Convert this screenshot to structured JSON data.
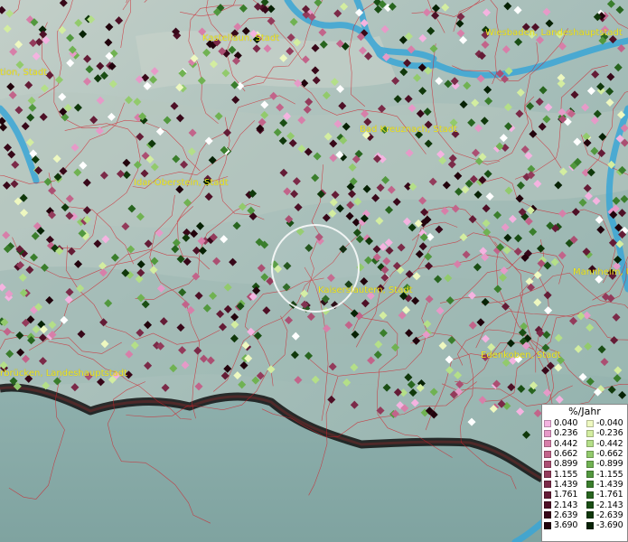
{
  "map": {
    "cities": [
      {
        "name": "Kastellaun, Stadt"
      },
      {
        "name": "Wiesbaden, Landeshauptstadt"
      },
      {
        "name": "tion, Stadt"
      },
      {
        "name": "Bad Kreuznach, Stadt"
      },
      {
        "name": "Idar-Oberstein, Stadt"
      },
      {
        "name": "Kaiserslautern, Stadt"
      },
      {
        "name": "Mannheim, U"
      },
      {
        "name": "rbrücken, Landeshauptstadt"
      },
      {
        "name": "Edenkoben, Stadt"
      }
    ],
    "colors": {
      "background": "#9fb8b4",
      "river": "#3aa6d6",
      "boundaries": "#d0202a",
      "label": "#f4ea1e",
      "circle": "#ffffff"
    }
  },
  "legend": {
    "title": "%/Jahr",
    "positive": [
      {
        "label": "0.040",
        "color": "#f4b3e0"
      },
      {
        "label": "0.236",
        "color": "#e69ac8"
      },
      {
        "label": "0.442",
        "color": "#d77fa9"
      },
      {
        "label": "0.662",
        "color": "#c2648a"
      },
      {
        "label": "0.899",
        "color": "#ab4f72"
      },
      {
        "label": "1.155",
        "color": "#933b5b"
      },
      {
        "label": "1.439",
        "color": "#7b2a48"
      },
      {
        "label": "1.761",
        "color": "#641c36"
      },
      {
        "label": "2.143",
        "color": "#4e1026"
      },
      {
        "label": "2.639",
        "color": "#380819"
      },
      {
        "label": "3.690",
        "color": "#22030c"
      }
    ],
    "negative": [
      {
        "label": "-0.040",
        "color": "#eef8c0"
      },
      {
        "label": "-0.236",
        "color": "#d3eda0"
      },
      {
        "label": "-0.442",
        "color": "#b4df88"
      },
      {
        "label": "-0.662",
        "color": "#92ca6c"
      },
      {
        "label": "-0.899",
        "color": "#70b252"
      },
      {
        "label": "-1.155",
        "color": "#52983e"
      },
      {
        "label": "-1.439",
        "color": "#3a7e2c"
      },
      {
        "label": "-1.761",
        "color": "#28651f"
      },
      {
        "label": "-2.143",
        "color": "#1a4e14"
      },
      {
        "label": "-2.639",
        "color": "#10380b"
      },
      {
        "label": "-3.690",
        "color": "#072205"
      }
    ]
  }
}
